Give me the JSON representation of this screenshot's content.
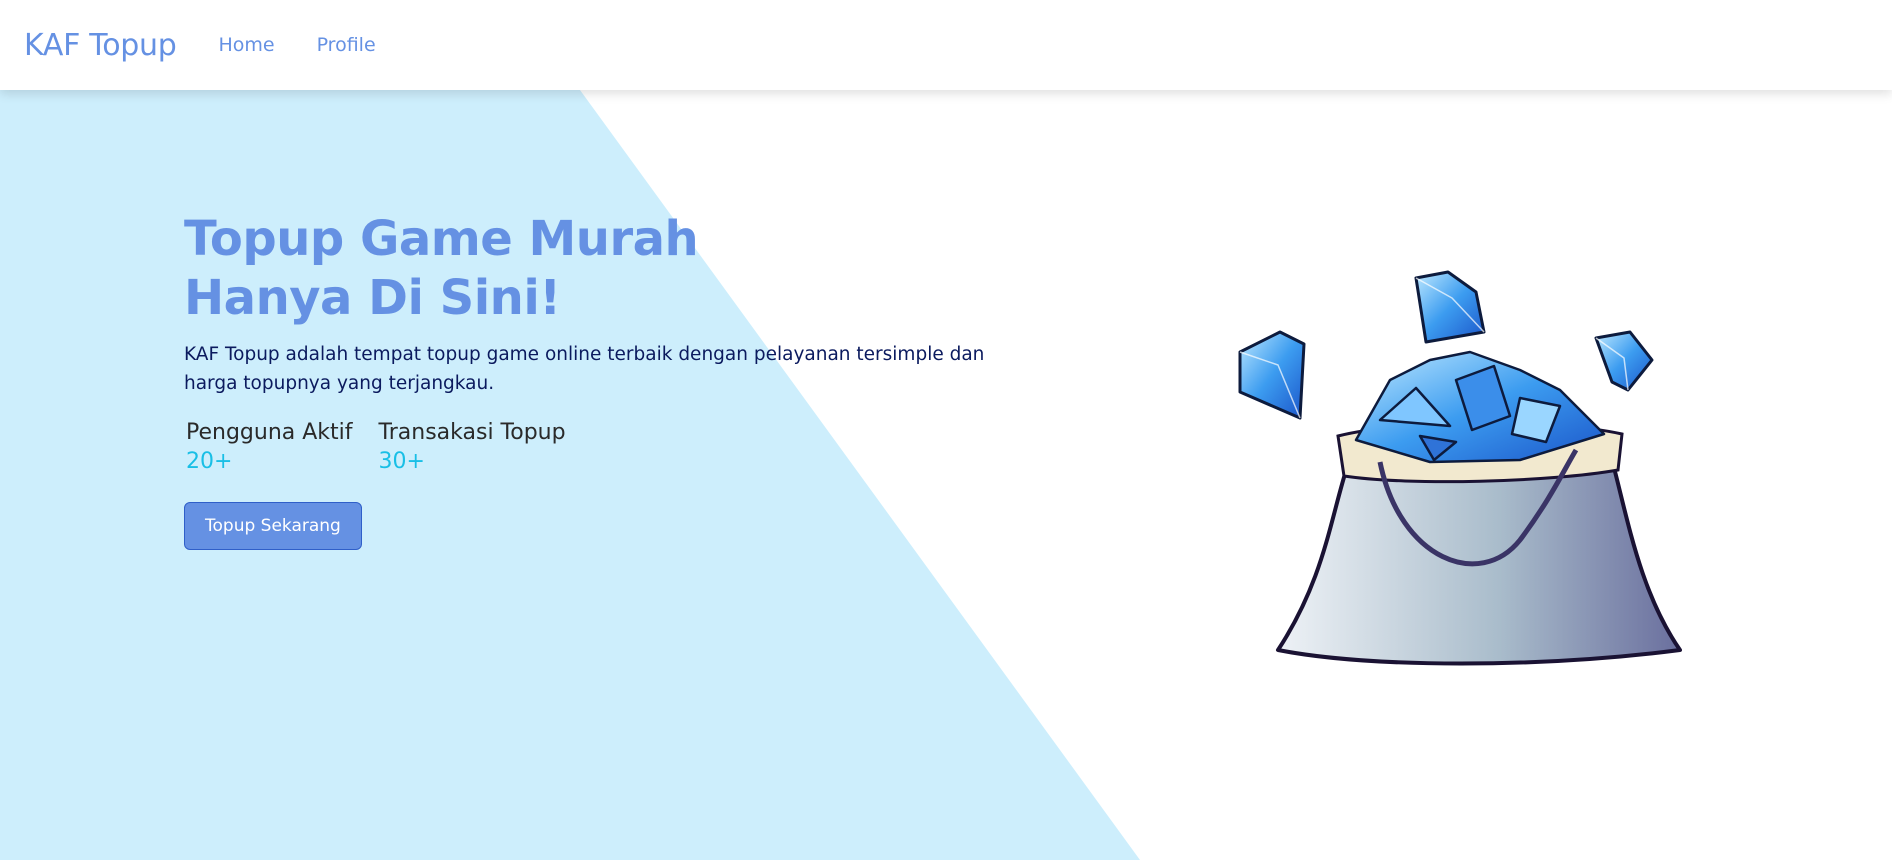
{
  "nav": {
    "brand": "KAF Topup",
    "links": [
      "Home",
      "Profile"
    ]
  },
  "hero": {
    "headline": "Topup Game Murah Hanya Di Sini!",
    "description": "KAF Topup adalah tempat topup game online terbaik dengan pelayanan tersimple dan harga topupnya yang terjangkau.",
    "stats": [
      {
        "label": "Pengguna Aktif",
        "value": "20+"
      },
      {
        "label": "Transakasi Topup",
        "value": "30+"
      }
    ],
    "cta_label": "Topup Sekarang",
    "illustration_icon": "diamond-bag-icon"
  },
  "colors": {
    "brand": "#6591e3",
    "hero_bg": "#cdeefc",
    "stat_value": "#19bfe6",
    "text_dark": "#0b1a5e"
  }
}
